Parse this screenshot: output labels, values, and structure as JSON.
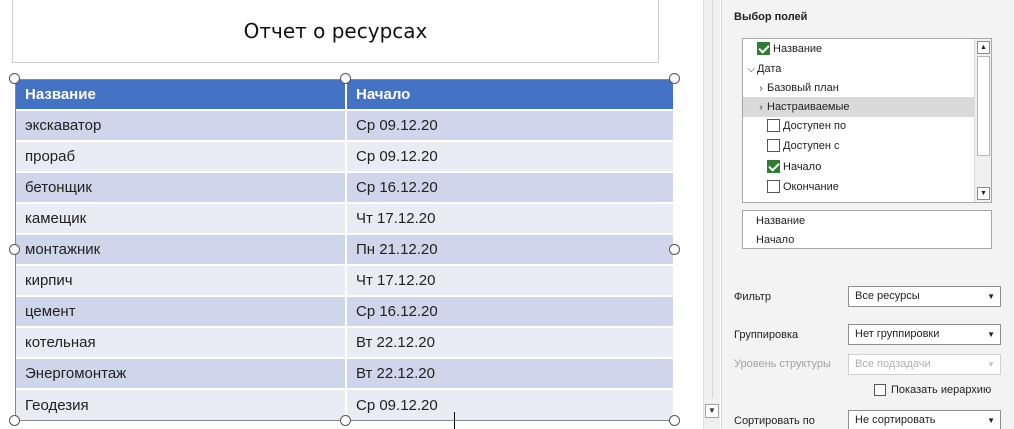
{
  "report": {
    "title": "Отчет о ресурсах",
    "columns": [
      "Название",
      "Начало"
    ],
    "rows": [
      [
        "экскаватор",
        "Ср 09.12.20"
      ],
      [
        "прораб",
        "Ср 09.12.20"
      ],
      [
        "бетонщик",
        "Ср 16.12.20"
      ],
      [
        "камещик",
        "Чт 17.12.20"
      ],
      [
        "монтажник",
        "Пн 21.12.20"
      ],
      [
        "кирпич",
        "Чт 17.12.20"
      ],
      [
        "цемент",
        "Ср 16.12.20"
      ],
      [
        "котельная",
        "Вт 22.12.20"
      ],
      [
        "Энергомонтаж",
        "Вт 22.12.20"
      ],
      [
        "Геодезия",
        "Ср 09.12.20"
      ]
    ]
  },
  "field_pane": {
    "title": "Выбор полей",
    "tree": [
      {
        "label": "Название",
        "kind": "checkbox",
        "checked": true
      },
      {
        "label": "Дата",
        "kind": "group",
        "expanded": true
      },
      {
        "label": "Базовый план",
        "kind": "group",
        "expanded": false
      },
      {
        "label": "Настраиваемые",
        "kind": "group",
        "expanded": false,
        "highlighted": true
      },
      {
        "label": "Доступен по",
        "kind": "checkbox",
        "checked": false
      },
      {
        "label": "Доступен с",
        "kind": "checkbox",
        "checked": false
      },
      {
        "label": "Начало",
        "kind": "checkbox",
        "checked": true
      },
      {
        "label": "Окончание",
        "kind": "checkbox",
        "checked": false
      }
    ],
    "selected_fields": [
      "Название",
      "Начало"
    ],
    "filter": {
      "label": "Фильтр",
      "value": "Все ресурсы"
    },
    "grouping": {
      "label": "Группировка",
      "value": "Нет группировки"
    },
    "outline_level": {
      "label": "Уровень структуры",
      "value": "Все подзадачи",
      "disabled": true
    },
    "show_hierarchy": {
      "label": "Показать иерархию",
      "checked": false
    },
    "sort": {
      "label": "Сортировать по",
      "value": "Не сортировать"
    }
  },
  "colors": {
    "header_bg": "#4472c4",
    "row_odd": "#cfd5ea",
    "row_even": "#e9ebf5",
    "checkbox_on": "#2f7d32"
  }
}
